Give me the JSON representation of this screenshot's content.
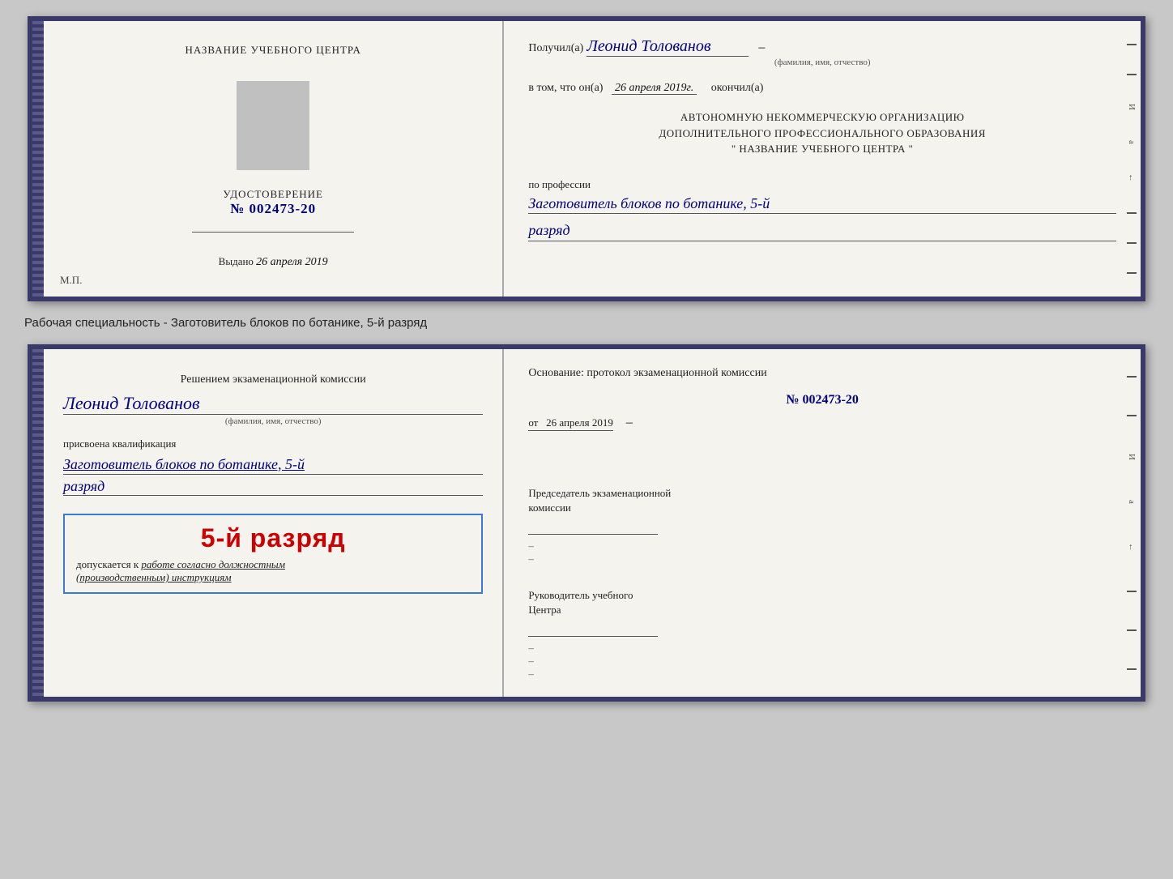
{
  "top_card": {
    "left": {
      "center_title": "НАЗВАНИЕ УЧЕБНОГО ЦЕНТРА",
      "doc_type": "УДОСТОВЕРЕНИЕ",
      "doc_number_prefix": "№",
      "doc_number": "002473-20",
      "vydano_label": "Выдано",
      "vydano_date": "26 апреля 2019",
      "mp_label": "М.П."
    },
    "right": {
      "poluchil_prefix": "Получил(а)",
      "recipient_name": "Леонид Толованов",
      "fio_sub": "(фамилия, имя, отчество)",
      "vtom_prefix": "в том, что он(а)",
      "vtom_date": "26 апреля 2019г.",
      "okonchil": "окончил(а)",
      "autonomous_line1": "АВТОНОМНУЮ НЕКОММЕРЧЕСКУЮ ОРГАНИЗАЦИЮ",
      "autonomous_line2": "ДОПОЛНИТЕЛЬНОГО ПРОФЕССИОНАЛЬНОГО ОБРАЗОВАНИЯ",
      "autonomous_line3": "\"  НАЗВАНИЕ УЧЕБНОГО ЦЕНТРА  \"",
      "profession_label": "по профессии",
      "profession_value": "Заготовитель блоков по ботанике, 5-й",
      "razryad_value": "разряд"
    }
  },
  "doc_label": "Рабочая специальность - Заготовитель блоков по ботанике, 5-й разряд",
  "bottom_card": {
    "left": {
      "komissia_title": "Решением экзаменационной комиссии",
      "person_name": "Леонид Толованов",
      "fio_sub": "(фамилия, имя, отчество)",
      "prisvoena_label": "присвоена квалификация",
      "kvalif_value": "Заготовитель блоков по ботанике, 5-й",
      "razryad_value": "разряд",
      "stamp_main": "5-й разряд",
      "stamp_dopusk": "допускается к",
      "stamp_italic": "работе согласно должностным",
      "stamp_italic2": "(производственным) инструкциям"
    },
    "right": {
      "osnovanie_title": "Основание: протокол экзаменационной комиссии",
      "prot_number": "№  002473-20",
      "ot_label": "от",
      "ot_date": "26 апреля 2019",
      "predsedatel_line1": "Председатель экзаменационной",
      "predsedatel_line2": "комиссии",
      "rukov_line1": "Руководитель учебного",
      "rukov_line2": "Центра"
    }
  },
  "edge_marks": {
    "dash_count": 8,
    "letters": [
      "И",
      "а",
      "←"
    ]
  }
}
